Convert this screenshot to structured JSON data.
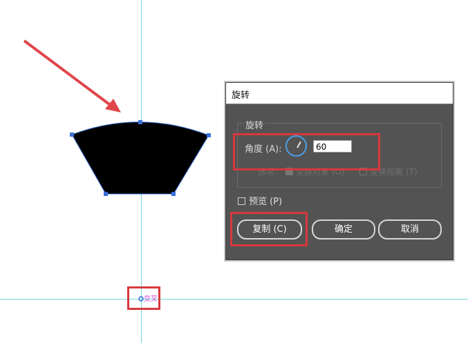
{
  "canvas": {
    "intersect_label": "交叉",
    "guide_color": "#6fd6dc",
    "shape_color": "#000000",
    "anchor_color": "#3b6fd6",
    "arrow_color": "#e0454a",
    "highlight_color": "#d8383e"
  },
  "dialog": {
    "title": "旋转",
    "group_label": "旋转",
    "angle_label": "角度 (A):",
    "angle_value": "60",
    "options_label": "选项：",
    "option_transform_objects": "变换对象 (O)",
    "option_transform_patterns": "变换图案 (T)",
    "preview_label": "预览 (P)",
    "buttons": {
      "copy": "复制 (C)",
      "ok": "确定",
      "cancel": "取消"
    },
    "accent_color": "#4a9ee8",
    "background_color": "#535353"
  }
}
